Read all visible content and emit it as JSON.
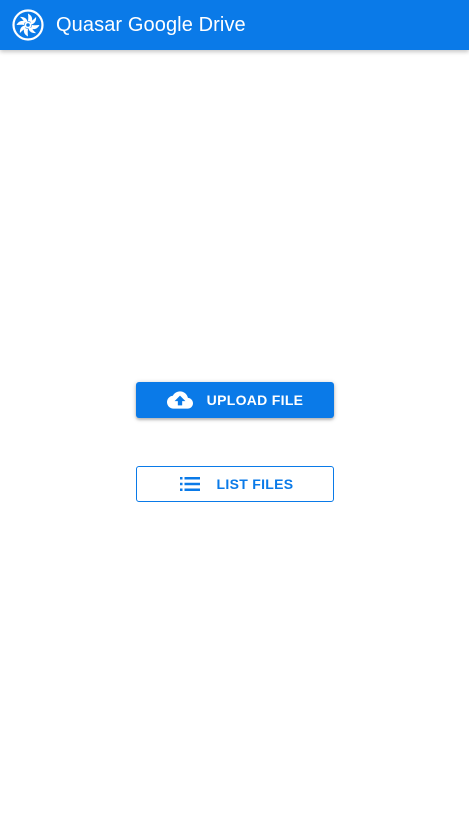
{
  "header": {
    "logo_icon": "quasar-logo-icon",
    "title": "Quasar Google Drive",
    "background_color": "#0a7ae8"
  },
  "actions": {
    "upload": {
      "icon": "cloud-upload-icon",
      "label": "UPLOAD FILE"
    },
    "list": {
      "icon": "list-icon",
      "label": "LIST FILES"
    }
  },
  "colors": {
    "primary": "#0a7ae8",
    "on_primary": "#ffffff"
  }
}
